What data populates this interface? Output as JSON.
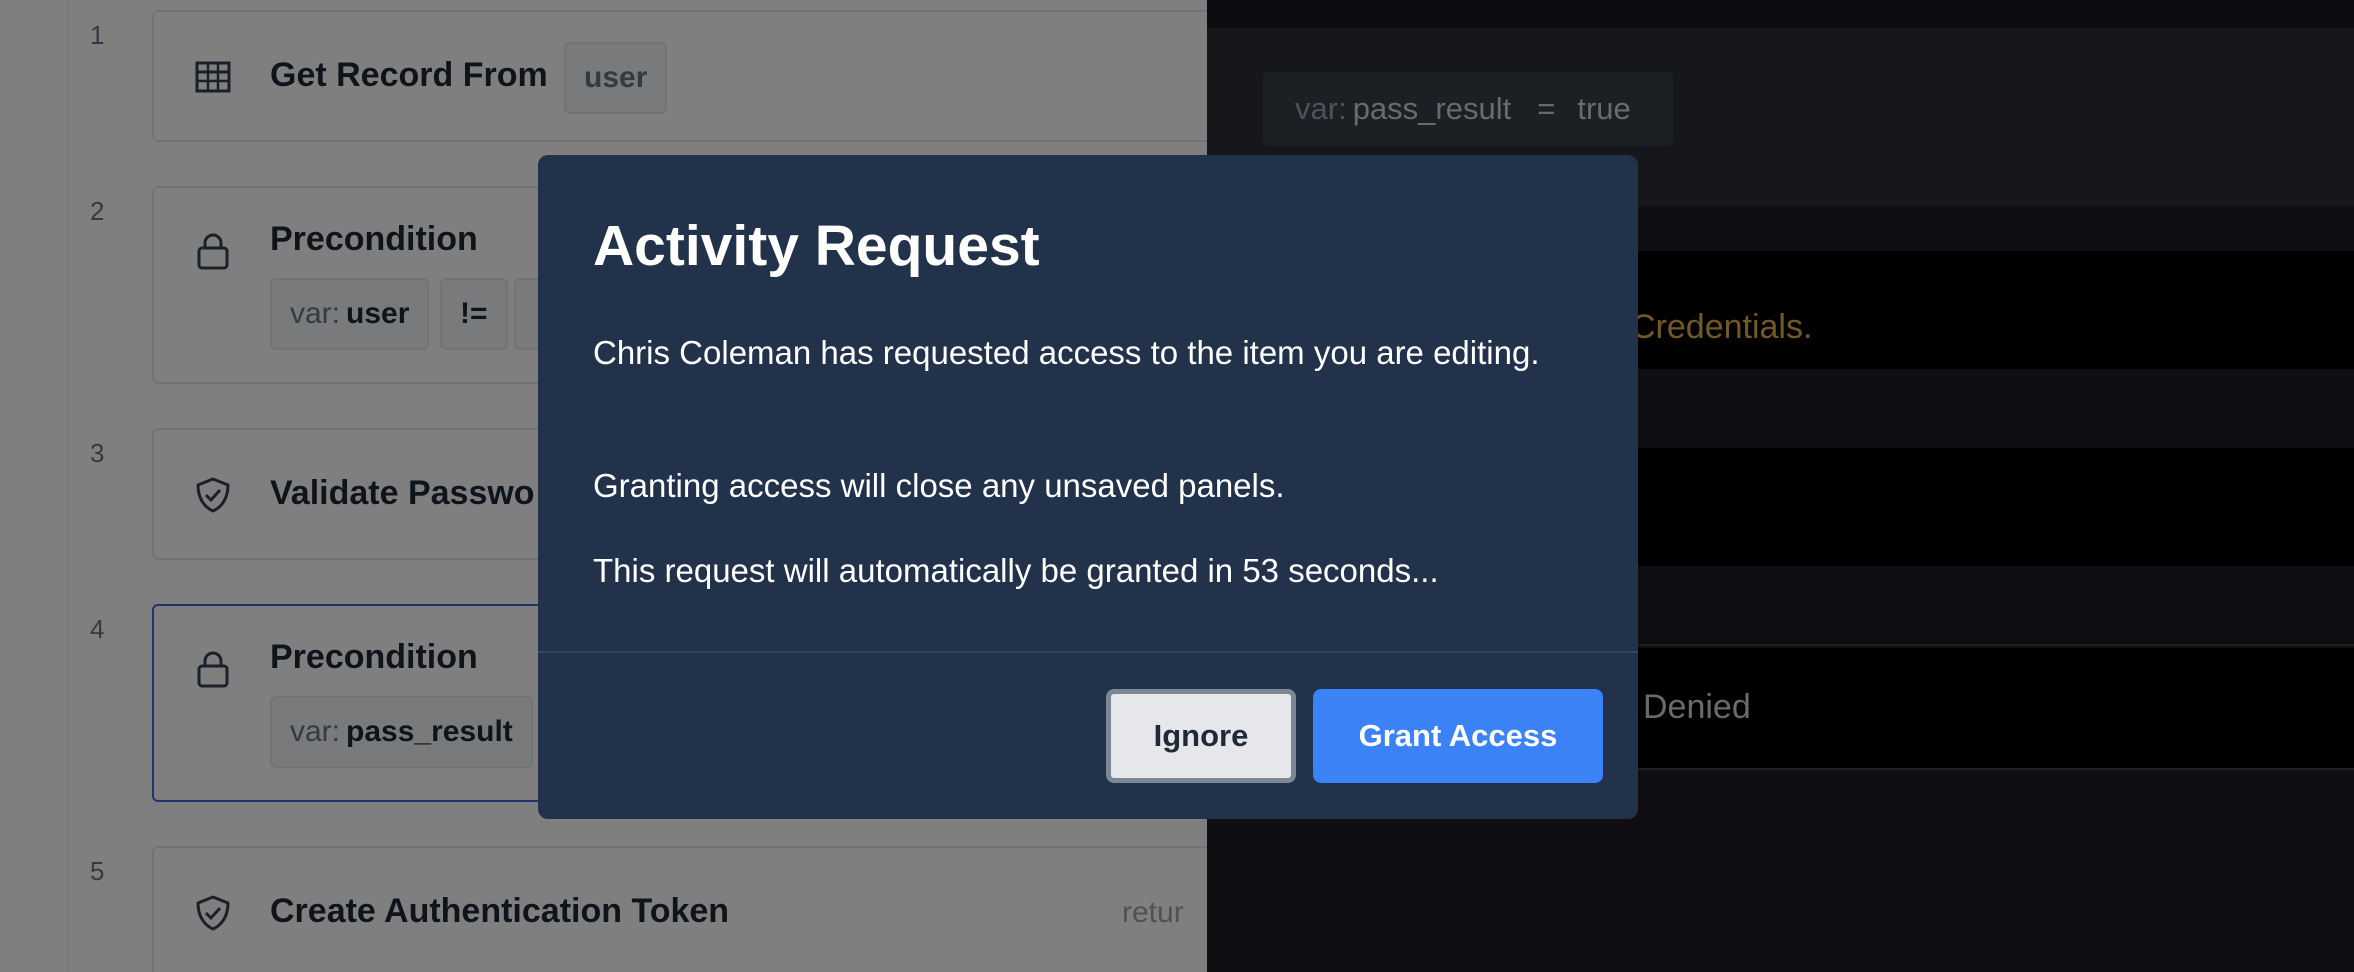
{
  "function_stack": {
    "steps": [
      {
        "number": "1",
        "icon": "table-icon",
        "title": "Get Record From",
        "chip_value": "user"
      },
      {
        "number": "2",
        "icon": "lock-icon",
        "title": "Precondition",
        "chips": [
          {
            "prefix": "var:",
            "value": "user"
          },
          {
            "value": "!="
          }
        ]
      },
      {
        "number": "3",
        "icon": "shield-check-icon",
        "title": "Validate Passwo"
      },
      {
        "number": "4",
        "icon": "lock-icon",
        "title": "Precondition",
        "chips": [
          {
            "prefix": "var:",
            "value": "pass_result"
          }
        ]
      },
      {
        "number": "5",
        "icon": "shield-check-icon",
        "title": "Create Authentication Token",
        "right_text": "retur"
      }
    ]
  },
  "side_panel": {
    "var_chip": {
      "prefix": "var:",
      "name": "pass_result",
      "operator": "=",
      "value": "true"
    },
    "message_1": "Credentials.",
    "message_2": "Denied"
  },
  "dialog": {
    "title": "Activity Request",
    "paragraph_1": "Chris Coleman has requested access to the item you are editing.",
    "paragraph_2": "Granting access will close any unsaved panels.",
    "paragraph_3": "This request will automatically be granted in 53 seconds...",
    "ignore_label": "Ignore",
    "grant_label": "Grant Access"
  },
  "colors": {
    "dialog_bg": "#21324a",
    "primary_button": "#3b82f6",
    "selected_card_border": "#3b6fd8",
    "warning_text": "#e4b04a"
  }
}
